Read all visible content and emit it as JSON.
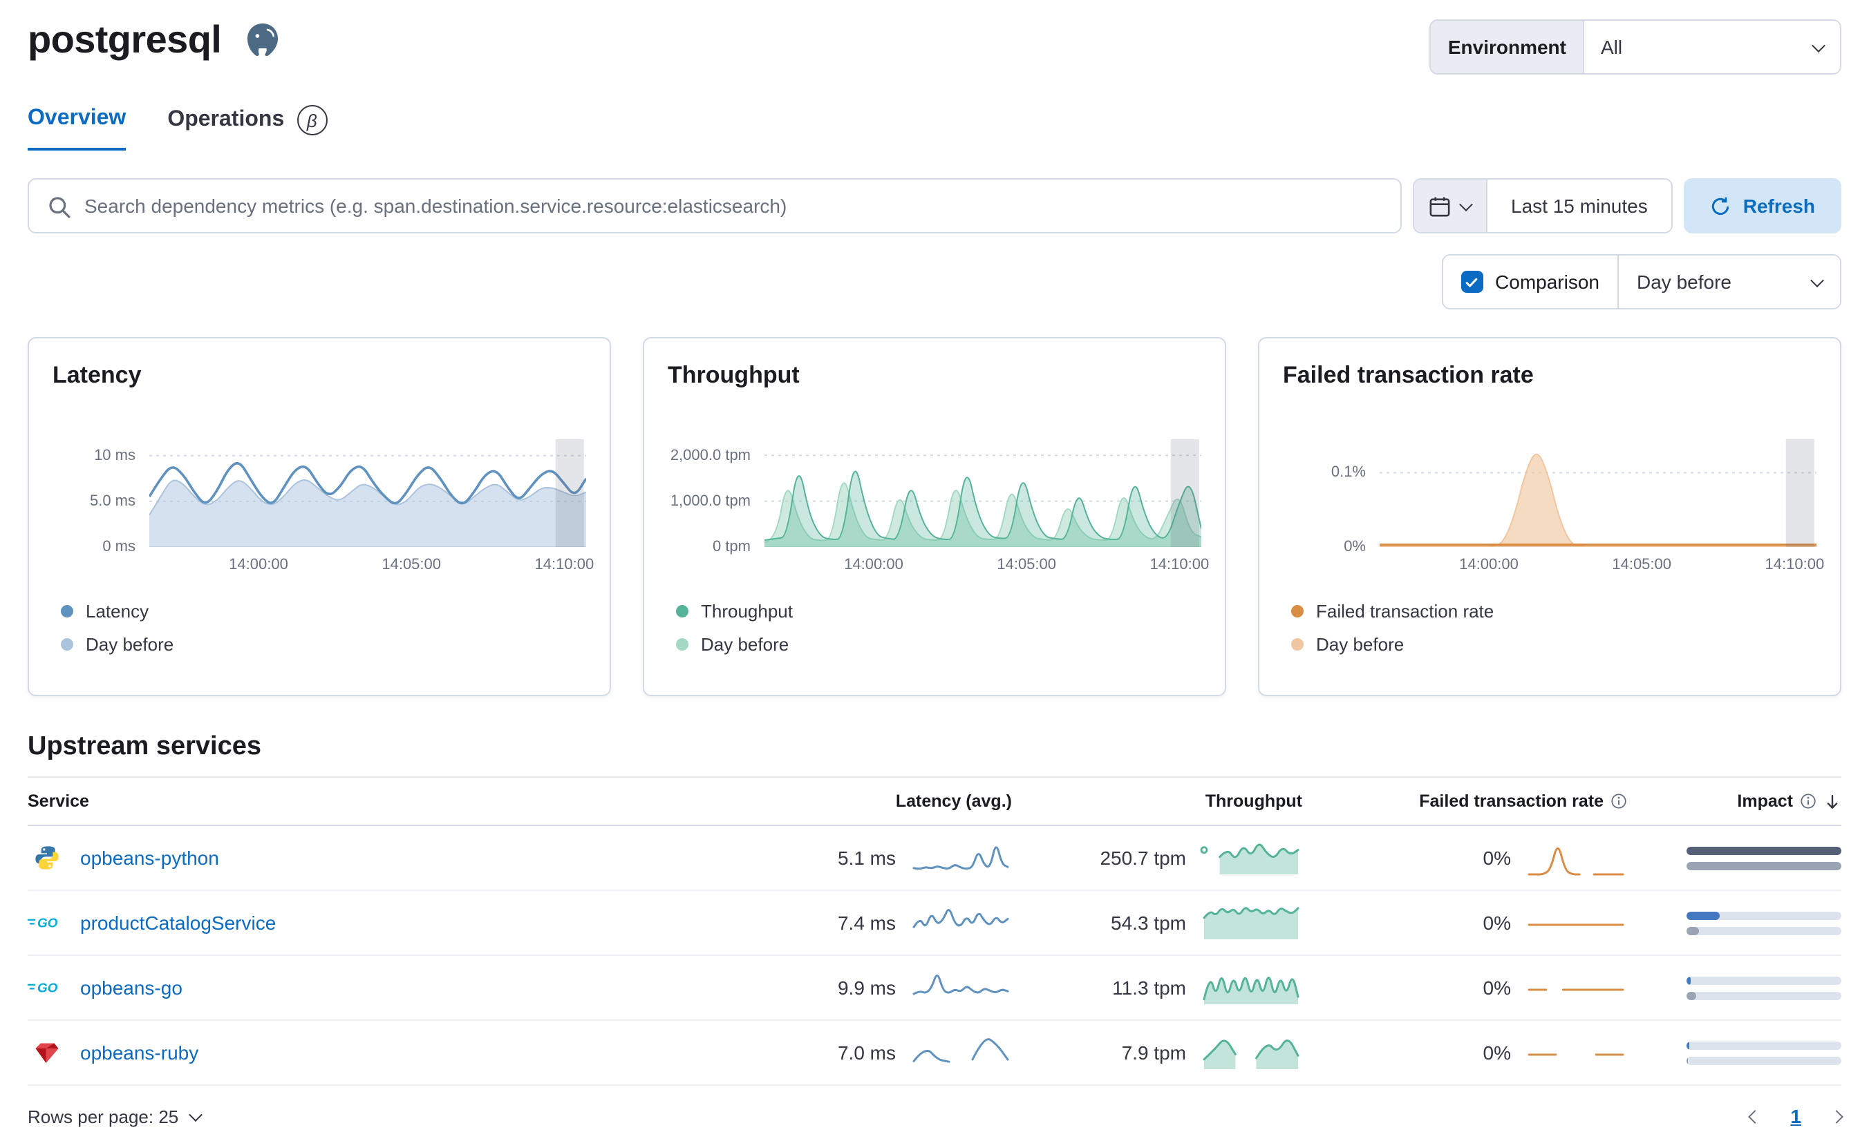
{
  "header": {
    "title": "postgresql",
    "environment_label": "Environment",
    "environment_value": "All"
  },
  "tabs": [
    {
      "label": "Overview",
      "active": true
    },
    {
      "label": "Operations",
      "badge": "β"
    }
  ],
  "toolbar": {
    "search_placeholder": "Search dependency metrics (e.g. span.destination.service.resource:elasticsearch)",
    "time_range": "Last 15 minutes",
    "refresh_label": "Refresh"
  },
  "comparison": {
    "label": "Comparison",
    "checked": true,
    "value": "Day before"
  },
  "colors": {
    "latency": "#6092c0",
    "latency_comparison": "#abc3dd",
    "throughput": "#54b399",
    "throughput_comparison": "#a5d8c3",
    "failed": "#d98c44",
    "failed_comparison": "#f0c7a0",
    "impact_fill": "#4479c2",
    "impact_prev_fill": "#9aa4b5",
    "accent_blue": "#0b6bc2"
  },
  "chart_data": [
    {
      "type": "line",
      "title": "Latency",
      "y_max": 11.8,
      "y_ticks": [
        {
          "value": 10,
          "label": "10 ms"
        },
        {
          "value": 5,
          "label": "5.0 ms"
        },
        {
          "value": 0,
          "label": "0 ms"
        }
      ],
      "x_ticks": [
        {
          "label": "14:00:00",
          "f": 0.25
        },
        {
          "label": "14:05:00",
          "f": 0.6
        },
        {
          "label": "14:10:00",
          "f": 0.95
        }
      ],
      "annotation_band": {
        "from": 0.93,
        "to": 0.995
      },
      "series": [
        {
          "name": "Day before",
          "color": "#abc3dd",
          "area": true,
          "fill_opacity": 0.5,
          "values": [
            3.5,
            5.5,
            7.5,
            7,
            5.5,
            4.5,
            5,
            6.5,
            7.5,
            6.5,
            5,
            4.5,
            5.5,
            7,
            7.5,
            6.5,
            5.5,
            5,
            6,
            7,
            6.5,
            5.5,
            4.5,
            5,
            6.5,
            7,
            6.5,
            5.5,
            4.5,
            5.5,
            6.5,
            7,
            6,
            5,
            5.5,
            6.5,
            6.5,
            6,
            5.5,
            6
          ]
        },
        {
          "name": "Latency",
          "color": "#6092c0",
          "area": false,
          "values": [
            5.5,
            7.5,
            9,
            8,
            6,
            4.5,
            6,
            8.5,
            9.5,
            7.5,
            5.5,
            4.5,
            6.5,
            8.5,
            9,
            7,
            5.5,
            6.5,
            8.5,
            9,
            7,
            5.5,
            4.5,
            6,
            8,
            9,
            7.5,
            5.5,
            4.5,
            6,
            8,
            8.5,
            6.5,
            5,
            6.5,
            8,
            8.5,
            7,
            5.5,
            7.5
          ]
        }
      ],
      "legend": [
        {
          "label": "Latency",
          "color": "#6092c0"
        },
        {
          "label": "Day before",
          "color": "#abc3dd"
        }
      ]
    },
    {
      "type": "line",
      "title": "Throughput",
      "y_max": 2350,
      "y_ticks": [
        {
          "value": 2000,
          "label": "2,000.0 tpm"
        },
        {
          "value": 1000,
          "label": "1,000.0 tpm"
        },
        {
          "value": 0,
          "label": "0 tpm"
        }
      ],
      "x_ticks": [
        {
          "label": "14:00:00",
          "f": 0.25
        },
        {
          "label": "14:05:00",
          "f": 0.6
        },
        {
          "label": "14:10:00",
          "f": 0.95
        }
      ],
      "annotation_band": {
        "from": 0.93,
        "to": 0.995
      },
      "series": [
        {
          "name": "Day before",
          "color": "#a5d8c3",
          "area": true,
          "fill_opacity": 0.55,
          "values": [
            100,
            140,
            1500,
            600,
            180,
            140,
            160,
            1700,
            700,
            200,
            160,
            140,
            1250,
            500,
            180,
            150,
            160,
            1500,
            620,
            200,
            160,
            180,
            1400,
            560,
            200,
            160,
            140,
            1000,
            420,
            180,
            150,
            160,
            1300,
            520,
            200,
            160,
            700,
            1200,
            320,
            220
          ]
        },
        {
          "name": "Throughput",
          "color": "#54b399",
          "area": true,
          "fill_opacity": 0.3,
          "values": [
            150,
            180,
            220,
            1900,
            700,
            220,
            160,
            180,
            2000,
            850,
            250,
            180,
            160,
            1500,
            600,
            220,
            160,
            180,
            1850,
            750,
            250,
            180,
            200,
            1700,
            700,
            220,
            180,
            160,
            1300,
            500,
            200,
            160,
            180,
            1600,
            650,
            220,
            180,
            950,
            1500,
            400
          ]
        }
      ],
      "legend": [
        {
          "label": "Throughput",
          "color": "#54b399"
        },
        {
          "label": "Day before",
          "color": "#a5d8c3"
        }
      ]
    },
    {
      "type": "line",
      "title": "Failed transaction rate",
      "y_max": 0.145,
      "y_ticks": [
        {
          "value": 0.1,
          "label": "0.1%"
        },
        {
          "value": 0,
          "label": "0%"
        }
      ],
      "x_ticks": [
        {
          "label": "14:00:00",
          "f": 0.25
        },
        {
          "label": "14:05:00",
          "f": 0.6
        },
        {
          "label": "14:10:00",
          "f": 0.95
        }
      ],
      "annotation_band": {
        "from": 0.93,
        "to": 0.995
      },
      "series": [
        {
          "name": "Day before",
          "color": "#f0c7a0",
          "area": true,
          "fill_opacity": 0.65,
          "values": [
            0,
            0,
            0,
            0,
            0,
            0,
            0,
            0,
            0,
            0,
            0,
            0.005,
            0.04,
            0.1,
            0.133,
            0.1,
            0.04,
            0.005,
            0,
            0,
            0,
            0,
            0,
            0,
            0,
            0,
            0,
            0,
            0,
            0,
            0,
            0,
            0,
            0,
            0,
            0,
            0,
            0,
            0,
            0
          ]
        },
        {
          "name": "Failed transaction rate",
          "color": "#d98c44",
          "area": false,
          "values": [
            0.003,
            0.003
          ]
        }
      ],
      "legend": [
        {
          "label": "Failed transaction rate",
          "color": "#d98c44"
        },
        {
          "label": "Day before",
          "color": "#f0c7a0"
        }
      ]
    }
  ],
  "upstream": {
    "title": "Upstream services",
    "columns": [
      {
        "label": "Service"
      },
      {
        "label": "Latency (avg.)"
      },
      {
        "label": "Throughput"
      },
      {
        "label": "Failed transaction rate",
        "info": true
      },
      {
        "label": "Impact",
        "info": true,
        "sorted": "desc"
      }
    ],
    "rows": [
      {
        "service": "opbeans-python",
        "icon": "python",
        "latency": "5.1 ms",
        "throughput": "250.7 tpm",
        "failed_rate": "0%",
        "impact": 100,
        "impact_prev": 100,
        "impact_color": "#556179",
        "latency_spark": [
          1.6,
          1.3,
          1.9,
          1.5,
          2.1,
          1.6,
          1.4,
          2.6,
          1.7,
          1.4,
          1.8,
          6.2,
          2.3,
          1.7,
          8.4,
          2.6,
          1.9
        ],
        "throughput_spark": [
          1.4,
          null,
          1,
          1.5,
          0.8,
          1.7,
          1,
          1.9,
          1.2,
          0.9,
          1.6,
          1.1,
          1.4
        ],
        "failed_spark": [
          0,
          0,
          0,
          0.15,
          1,
          0.12,
          0,
          0,
          null,
          0,
          0,
          0,
          0,
          0
        ]
      },
      {
        "service": "productCatalogService",
        "icon": "go",
        "latency": "7.4 ms",
        "throughput": "54.3 tpm",
        "failed_rate": "0%",
        "impact": 21,
        "impact_prev": 8,
        "latency_spark": [
          2.5,
          4.5,
          2.2,
          5.5,
          3,
          4,
          6.8,
          3.2,
          2.6,
          4.8,
          2.8,
          5.8,
          3.8,
          2.8,
          4.8,
          3.2,
          4.2
        ],
        "throughput_spark": [
          2,
          2.7,
          2.2,
          3,
          2.4,
          2.9,
          2.2,
          3.1,
          2.5,
          2.9,
          2.3,
          2.8,
          2.2,
          3,
          2.6,
          2.4,
          2.9
        ],
        "failed_spark": [
          0,
          0,
          0,
          0,
          0,
          0,
          0,
          0,
          0,
          0,
          0,
          0
        ]
      },
      {
        "service": "opbeans-go",
        "icon": "go",
        "latency": "9.9 ms",
        "throughput": "11.3 tpm",
        "failed_rate": "0%",
        "impact": 3,
        "impact_prev": 6,
        "latency_spark": [
          2,
          2.6,
          2.1,
          3.1,
          6.4,
          2.6,
          2.1,
          2.9,
          2.4,
          3.6,
          2.6,
          2.1,
          3.1,
          2.6,
          2.2,
          2.9,
          2.5
        ],
        "throughput_spark": [
          0.6,
          3.6,
          0.9,
          3.9,
          0.7,
          3.5,
          1,
          3.9,
          0.8,
          3.6,
          0.9,
          4,
          0.7,
          3.5,
          1,
          3.7,
          0.9
        ],
        "failed_spark": [
          0,
          0,
          0,
          null,
          0,
          0,
          0,
          0,
          0,
          0,
          0,
          0
        ]
      },
      {
        "service": "opbeans-ruby",
        "icon": "ruby",
        "latency": "7.0 ms",
        "throughput": "7.9 tpm",
        "failed_rate": "0%",
        "impact": 1.5,
        "impact_prev": 1,
        "latency_spark": [
          1.5,
          4.3,
          1.8,
          1.4,
          null,
          1.8,
          6.2,
          4.8,
          1.8
        ],
        "throughput_spark": [
          0.8,
          1.6,
          2.6,
          1.2,
          null,
          0.9,
          2.3,
          1.3,
          2.7,
          1.1
        ],
        "failed_spark": [
          0,
          0,
          0,
          null,
          null,
          0,
          0,
          0
        ]
      }
    ],
    "footer": {
      "rows_per_page": "Rows per page: 25",
      "page": "1"
    }
  }
}
